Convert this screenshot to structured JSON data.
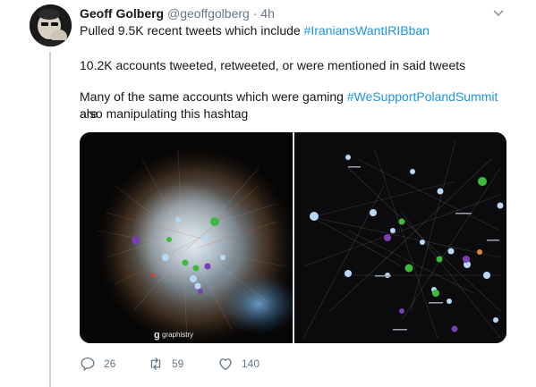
{
  "tweet": {
    "author": {
      "name": "Geoff Golberg",
      "handle": "@geoffgolberg",
      "separator": "·",
      "time": "4h"
    },
    "paragraph1": {
      "prefix": "Pulled 9.5K recent tweets which include ",
      "hashtag": "#IraniansWantIRIBban"
    },
    "paragraph2": "10.2K accounts tweeted, retweeted, or were mentioned in said tweets",
    "paragraph3": {
      "prefix": "Many of the same accounts which were gaming ",
      "hashtag": "#WeSupportPolandSummit",
      "suffix": " are",
      "line2": "also manipulating this hashtag"
    },
    "media": {
      "watermark": "graphistry"
    },
    "actions": {
      "replies": "26",
      "retweets": "59",
      "likes": "140"
    }
  },
  "colors": {
    "link": "#1b95e0",
    "muted": "#657786",
    "thread": "#c4cfd6",
    "graph_green": "#3cba3c",
    "graph_purple": "#7b3fb5",
    "graph_node": "#b7d9f5"
  },
  "icons": [
    "caret-down-icon",
    "reply-icon",
    "retweet-icon",
    "like-icon"
  ]
}
